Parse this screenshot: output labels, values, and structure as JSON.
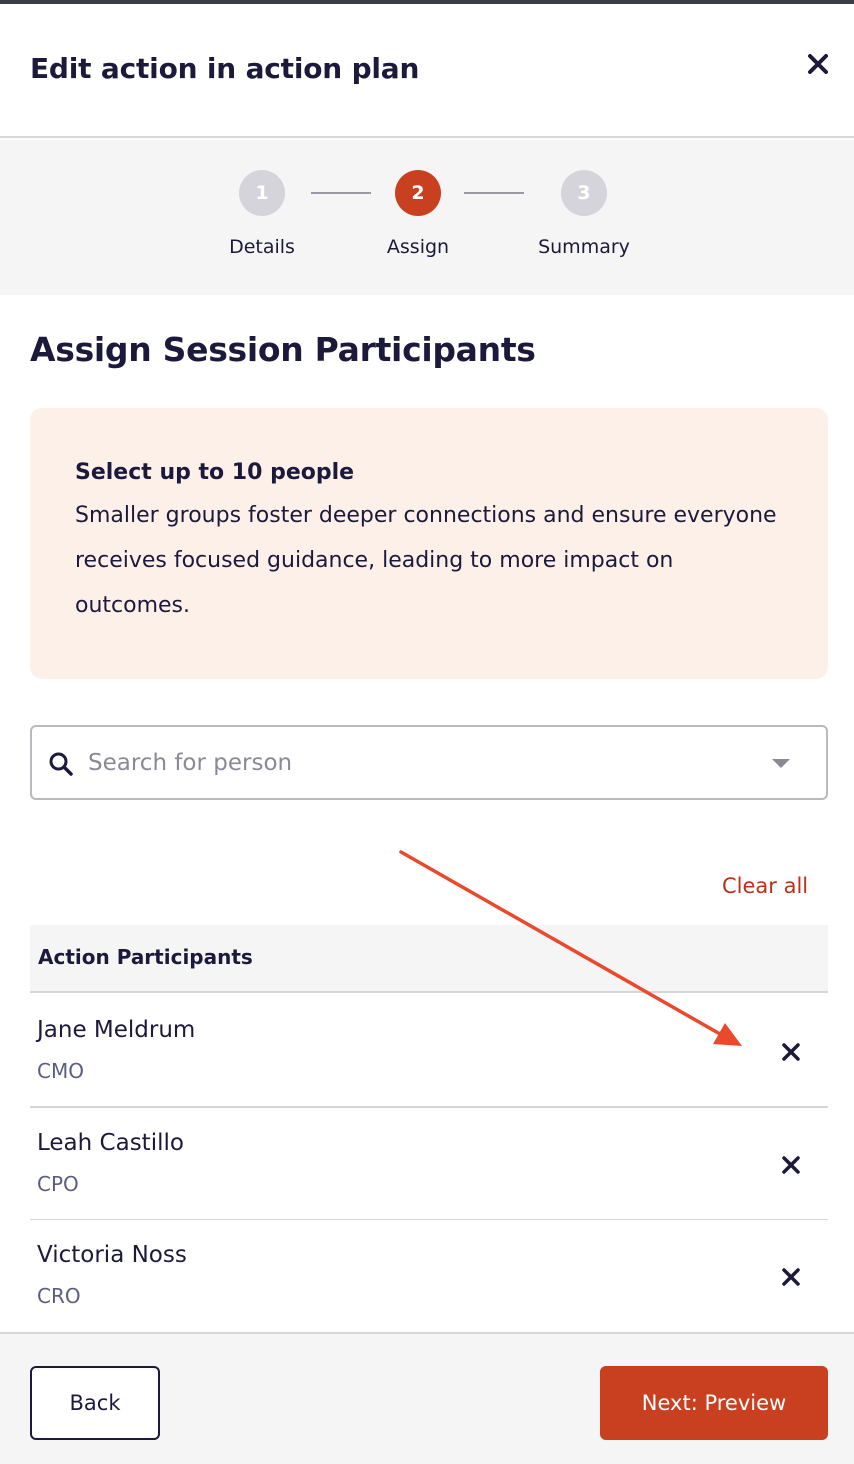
{
  "dialog": {
    "title": "Edit action in action plan",
    "close_icon": "close-icon"
  },
  "stepper": {
    "steps": [
      {
        "number": "1",
        "label": "Details",
        "state": "inactive"
      },
      {
        "number": "2",
        "label": "Assign",
        "state": "active"
      },
      {
        "number": "3",
        "label": "Summary",
        "state": "inactive"
      }
    ]
  },
  "section": {
    "title": "Assign Session Participants"
  },
  "info_box": {
    "heading": "Select up to 10 people",
    "body": "Smaller groups foster deeper connections and ensure everyone receives focused guidance, leading to more impact on outcomes."
  },
  "search": {
    "placeholder": "Search for person",
    "value": "",
    "icon": "search-icon"
  },
  "clear_all_label": "Clear all",
  "participants": {
    "header": "Action Participants",
    "rows": [
      {
        "name": "Jane Meldrum",
        "role": "CMO"
      },
      {
        "name": "Leah Castillo",
        "role": "CPO"
      },
      {
        "name": "Victoria Noss",
        "role": "CRO"
      }
    ]
  },
  "footer": {
    "back_label": "Back",
    "next_label": "Next: Preview"
  },
  "colors": {
    "accent": "#c8401f",
    "text": "#1c1a3b",
    "info_bg": "#fcf0e9",
    "annotation_arrow": "#e84a2e"
  }
}
